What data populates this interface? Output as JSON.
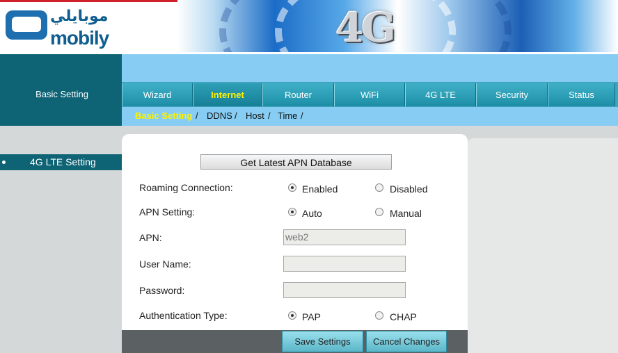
{
  "header": {
    "logo_arabic": "موبايلي",
    "logo_text": "mobily",
    "banner_text": "4G"
  },
  "sidebar": {
    "section_label": "Basic Setting",
    "items": [
      {
        "label": "4G LTE Setting",
        "active": true
      }
    ]
  },
  "main_tabs": [
    {
      "label": "Wizard",
      "active": false
    },
    {
      "label": "Internet",
      "active": true
    },
    {
      "label": "Router",
      "active": false
    },
    {
      "label": "WiFi",
      "active": false
    },
    {
      "label": "4G LTE",
      "active": false
    },
    {
      "label": "Security",
      "active": false
    },
    {
      "label": "Status",
      "active": false
    }
  ],
  "sub_tabs": [
    {
      "label": "Basic Setting",
      "active": true
    },
    {
      "label": "DDNS",
      "active": false
    },
    {
      "label": "Host",
      "active": false
    },
    {
      "label": "Time",
      "active": false
    }
  ],
  "sub_separator": "/",
  "form": {
    "apn_db_button": "Get Latest APN Database",
    "roaming": {
      "label": "Roaming Connection:",
      "options": [
        "Enabled",
        "Disabled"
      ],
      "selected": "Enabled"
    },
    "apn_setting": {
      "label": "APN Setting:",
      "options": [
        "Auto",
        "Manual"
      ],
      "selected": "Auto"
    },
    "apn": {
      "label": "APN:",
      "value": "web2"
    },
    "username": {
      "label": "User Name:",
      "value": ""
    },
    "password": {
      "label": "Password:",
      "value": ""
    },
    "auth_type": {
      "label": "Authentication Type:",
      "options": [
        "PAP",
        "CHAP"
      ],
      "selected": "PAP"
    }
  },
  "actions": {
    "save": "Save Settings",
    "cancel": "Cancel Changes"
  },
  "colors": {
    "brand_red": "#d21f2c",
    "brand_blue": "#0f5e8f",
    "nav_dark": "#0e6375",
    "nav_light": "#87cdf3",
    "active_tab_text": "#fff200"
  }
}
